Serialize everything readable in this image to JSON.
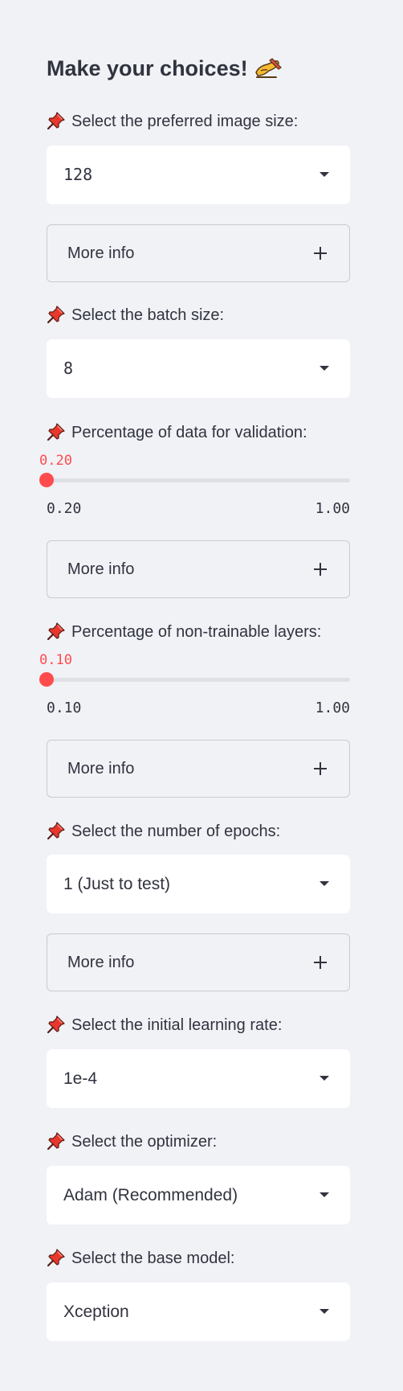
{
  "header": {
    "title": "Make your choices!",
    "title_icon": "writing-hand-emoji"
  },
  "icons": {
    "label_icon": "pushpin-icon",
    "pin_color": "#e8372c"
  },
  "colors": {
    "accent": "#ff4b4b",
    "background": "#f0f2f6",
    "widget_background": "#ffffff",
    "text": "#31333f"
  },
  "image_size": {
    "label": "Select the preferred image size:",
    "value": "128",
    "info": "More info"
  },
  "batch_size": {
    "label": "Select the batch size:",
    "value": "8"
  },
  "validation": {
    "label": "Percentage of data for validation:",
    "value": "0.20",
    "min": "0.20",
    "max": "1.00",
    "fraction": 0.0,
    "info": "More info"
  },
  "non_trainable": {
    "label": "Percentage of non-trainable layers:",
    "value": "0.10",
    "min": "0.10",
    "max": "1.00",
    "fraction": 0.0,
    "info": "More info"
  },
  "epochs": {
    "label": "Select the number of epochs:",
    "value": "1 (Just to test)",
    "info": "More info"
  },
  "learning_rate": {
    "label": "Select the initial learning rate:",
    "value": "1e-4"
  },
  "optimizer": {
    "label": "Select the optimizer:",
    "value": "Adam (Recommended)"
  },
  "base_model": {
    "label": "Select the base model:",
    "value": "Xception"
  }
}
